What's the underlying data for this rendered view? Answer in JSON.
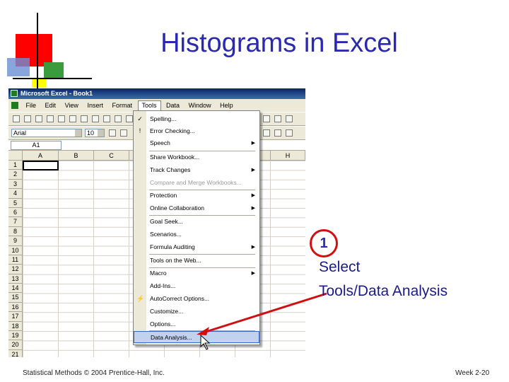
{
  "slide": {
    "title": "Histograms in Excel",
    "footer_left": "Statistical Methods © 2004 Prentice-Hall, Inc.",
    "footer_right": "Week 2-20"
  },
  "excel": {
    "window_title": "Microsoft Excel - Book1",
    "menu": [
      "File",
      "Edit",
      "View",
      "Insert",
      "Format",
      "Tools",
      "Data",
      "Window",
      "Help"
    ],
    "active_menu": "Tools",
    "font_name": "Arial",
    "font_size": "10",
    "name_box": "A1",
    "columns": [
      "A",
      "B",
      "C",
      "H"
    ],
    "rows": [
      "1",
      "2",
      "3",
      "4",
      "5",
      "6",
      "7",
      "8",
      "9",
      "10",
      "11",
      "12",
      "13",
      "14",
      "15",
      "16",
      "17",
      "18",
      "19",
      "20",
      "21"
    ]
  },
  "tools_menu": {
    "items": [
      {
        "label": "Spelling...",
        "shortcut_icon": "spelling-icon"
      },
      {
        "label": "Error Checking...",
        "shortcut_icon": "error-check-icon"
      },
      {
        "label": "Speech",
        "submenu": true
      },
      {
        "label": "Share Workbook..."
      },
      {
        "label": "Track Changes",
        "submenu": true
      },
      {
        "label": "Compare and Merge Workbooks...",
        "disabled": true
      },
      {
        "label": "Protection",
        "submenu": true
      },
      {
        "label": "Online Collaboration",
        "submenu": true
      },
      {
        "label": "Goal Seek..."
      },
      {
        "label": "Scenarios..."
      },
      {
        "label": "Formula Auditing",
        "submenu": true
      },
      {
        "label": "Tools on the Web..."
      },
      {
        "label": "Macro",
        "submenu": true
      },
      {
        "label": "Add-Ins..."
      },
      {
        "label": "AutoCorrect Options...",
        "shortcut_icon": "autocorrect-icon"
      },
      {
        "label": "Customize..."
      },
      {
        "label": "Options..."
      },
      {
        "label": "Data Analysis...",
        "highlighted": true
      }
    ]
  },
  "callout": {
    "step": "1",
    "line1": "Select",
    "line2": "Tools/Data Analysis",
    "color": "#d01010"
  }
}
